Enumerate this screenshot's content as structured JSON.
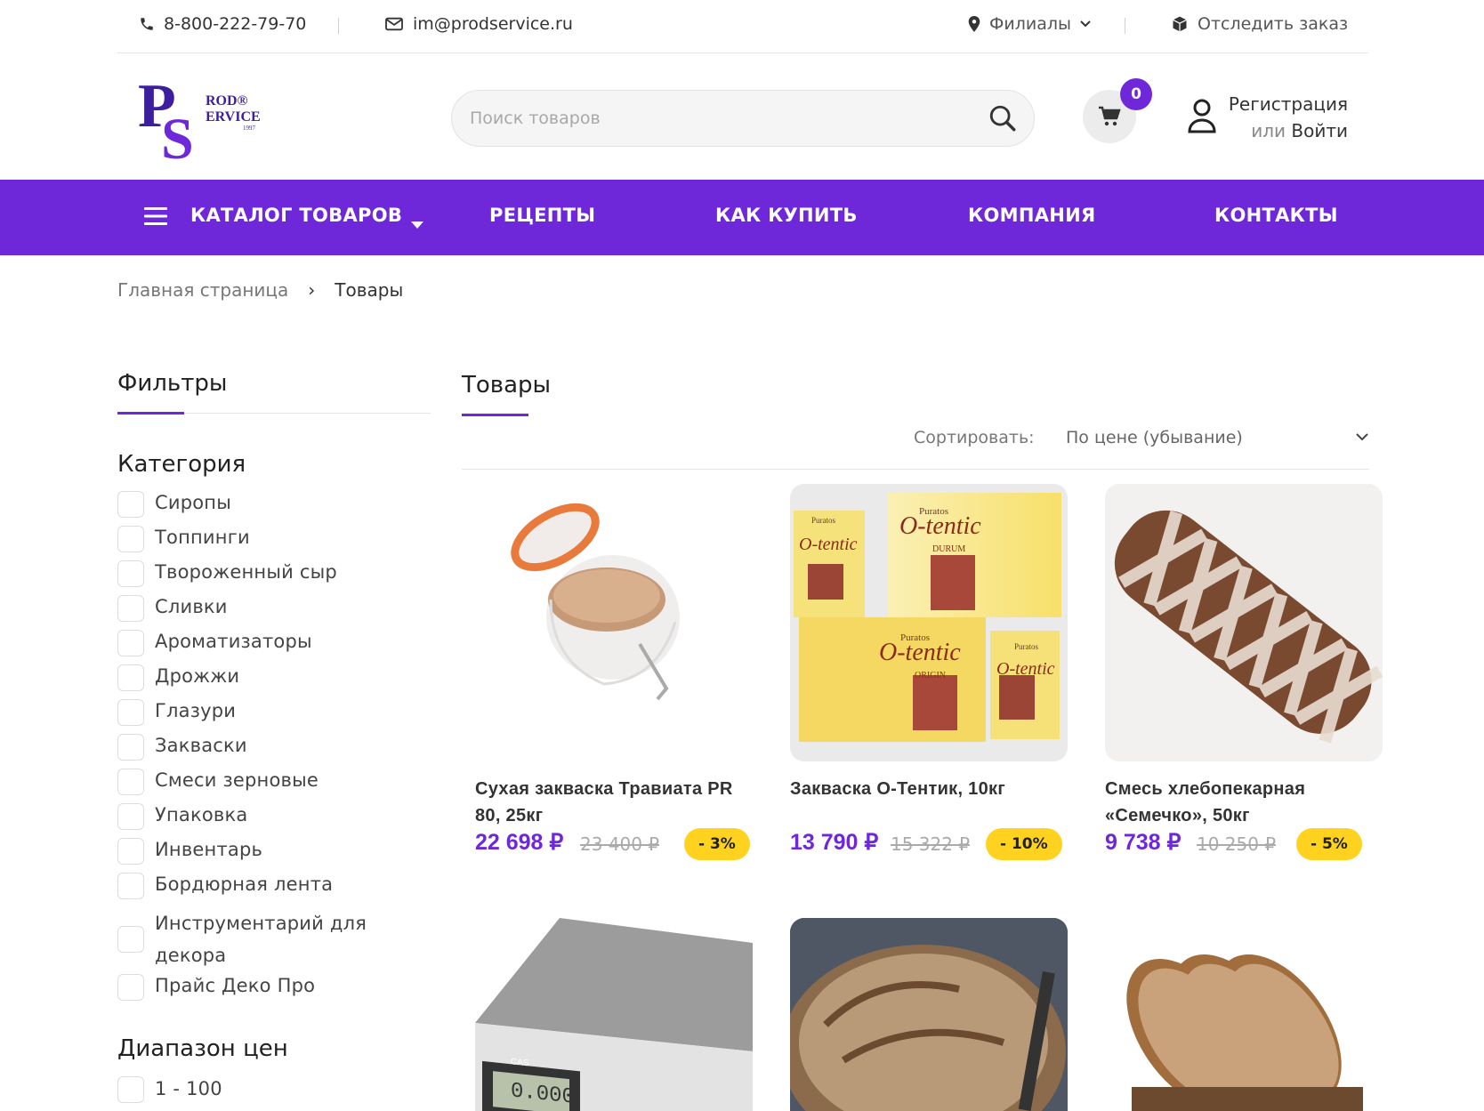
{
  "topbar": {
    "phone": "8-800-222-79-70",
    "email": "im@prodservice.ru",
    "branches": "Филиалы",
    "track": "Отследить заказ"
  },
  "logo": {
    "letters": "PS",
    "line1": "ROD®",
    "line2": "ERVICE",
    "line3": "1997"
  },
  "search": {
    "placeholder": "Поиск товаров"
  },
  "cart": {
    "count": "0"
  },
  "auth": {
    "register": "Регистрация",
    "or": "или ",
    "login": "Войти"
  },
  "nav": {
    "catalog": "КАТАЛОГ ТОВАРОВ",
    "recipes": "РЕЦЕПТЫ",
    "howto": "КАК КУПИТЬ",
    "company": "КОМПАНИЯ",
    "contacts": "КОНТАКТЫ"
  },
  "breadcrumb": {
    "home": "Главная страница",
    "sep": "›",
    "current": "Товары"
  },
  "filters": {
    "title": "Фильтры",
    "category_title": "Категория",
    "categories": [
      "Сиропы",
      "Топпинги",
      "Твороженный сыр",
      "Сливки",
      "Ароматизаторы",
      "Дрожжи",
      "Глазури",
      "Закваски",
      "Смеси зерновые",
      "Упаковка",
      "Инвентарь",
      "Бордюрная лента",
      "Инструментарий для декора",
      "Прайс Деко Про"
    ],
    "price_title": "Диапазон цен",
    "price_ranges": [
      "1 - 100"
    ]
  },
  "products_section": {
    "title": "Товары",
    "sort_label": "Сортировать:",
    "sort_value": "По цене (убывание)"
  },
  "products": [
    {
      "name": "Сухая закваска Травиата PR 80, 25кг",
      "price": "22 698 ₽",
      "old": "23 400 ₽",
      "discount": "- 3%"
    },
    {
      "name": "Закваска О-Тентик, 10кг",
      "price": "13 790 ₽",
      "old": "15 322 ₽",
      "discount": "- 10%"
    },
    {
      "name": "Смесь хлебопекарная «Семечко», 50кг",
      "price": "9 738 ₽",
      "old": "10 250 ₽",
      "discount": "- 5%"
    }
  ],
  "packaging": {
    "brand": "Puratos",
    "product": "O-tentic",
    "variant1": "DURUM",
    "variant2": "ORIGIN"
  },
  "scale": {
    "brand": "CAS",
    "display": "0.000"
  },
  "colors": {
    "accent": "#6f27da",
    "discount": "#ffd21f"
  }
}
